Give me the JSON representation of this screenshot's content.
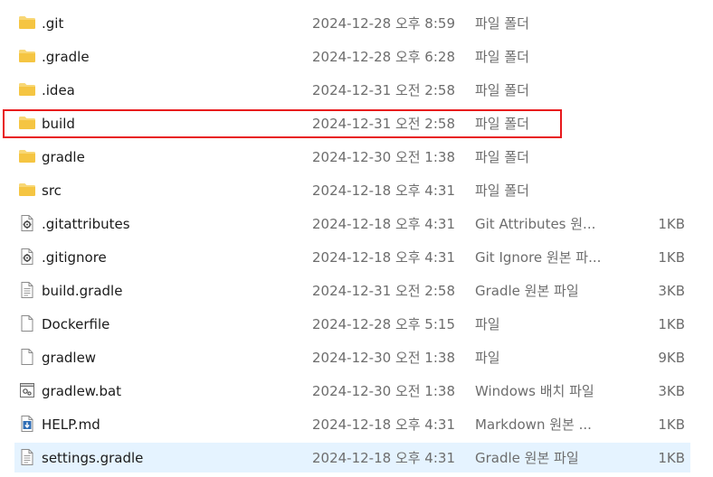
{
  "files": [
    {
      "name": ".git",
      "date": "2024-12-28 오후 8:59",
      "type": "파일 폴더",
      "size": "",
      "icon": "folder-icon"
    },
    {
      "name": ".gradle",
      "date": "2024-12-28 오후 6:28",
      "type": "파일 폴더",
      "size": "",
      "icon": "folder-icon"
    },
    {
      "name": ".idea",
      "date": "2024-12-31 오전 2:58",
      "type": "파일 폴더",
      "size": "",
      "icon": "folder-icon"
    },
    {
      "name": "build",
      "date": "2024-12-31 오전 2:58",
      "type": "파일 폴더",
      "size": "",
      "icon": "folder-icon"
    },
    {
      "name": "gradle",
      "date": "2024-12-30 오전 1:38",
      "type": "파일 폴더",
      "size": "",
      "icon": "folder-icon"
    },
    {
      "name": "src",
      "date": "2024-12-18 오후 4:31",
      "type": "파일 폴더",
      "size": "",
      "icon": "folder-icon"
    },
    {
      "name": ".gitattributes",
      "date": "2024-12-18 오후 4:31",
      "type": "Git Attributes 원...",
      "size": "1KB",
      "icon": "config-file-icon"
    },
    {
      "name": ".gitignore",
      "date": "2024-12-18 오후 4:31",
      "type": "Git Ignore 원본 파...",
      "size": "1KB",
      "icon": "config-file-icon"
    },
    {
      "name": "build.gradle",
      "date": "2024-12-31 오전 2:58",
      "type": "Gradle 원본 파일",
      "size": "3KB",
      "icon": "text-file-icon"
    },
    {
      "name": "Dockerfile",
      "date": "2024-12-28 오후 5:15",
      "type": "파일",
      "size": "1KB",
      "icon": "blank-file-icon"
    },
    {
      "name": "gradlew",
      "date": "2024-12-30 오전 1:38",
      "type": "파일",
      "size": "9KB",
      "icon": "blank-file-icon"
    },
    {
      "name": "gradlew.bat",
      "date": "2024-12-30 오전 1:38",
      "type": "Windows 배치 파일",
      "size": "3KB",
      "icon": "batch-file-icon"
    },
    {
      "name": "HELP.md",
      "date": "2024-12-18 오후 4:31",
      "type": "Markdown 원본 ...",
      "size": "1KB",
      "icon": "markdown-file-icon"
    },
    {
      "name": "settings.gradle",
      "date": "2024-12-18 오후 4:31",
      "type": "Gradle 원본 파일",
      "size": "1KB",
      "icon": "text-file-icon",
      "selected": true
    }
  ],
  "highlight": {
    "target": "build",
    "color": "#e8191c"
  },
  "colors": {
    "folder": "#f5c542",
    "selection": "#e5f3ff",
    "secondary_text": "#6d6d6d"
  }
}
